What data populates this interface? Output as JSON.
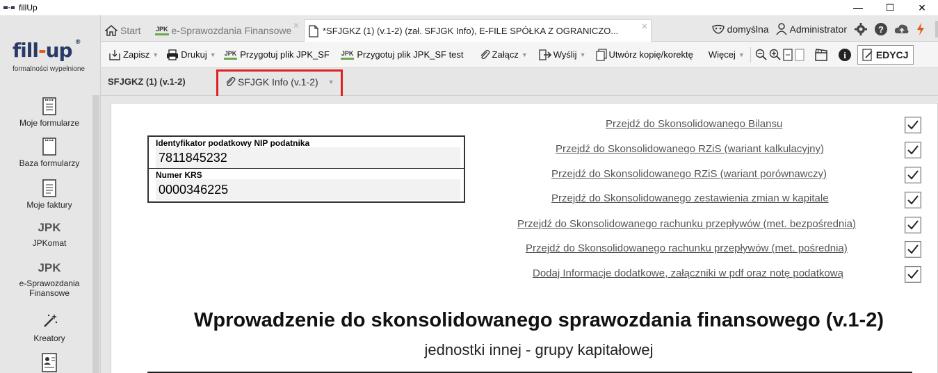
{
  "window": {
    "title": "fillUp",
    "controls": {
      "minimize": "—",
      "maximize": "☐",
      "close": "✕"
    }
  },
  "sidebar": {
    "logo": {
      "main_left": "fill",
      "main_dash": "-",
      "main_right": "up",
      "registered": "®",
      "tagline": "formalności wypełnione"
    },
    "items": [
      {
        "label": "Moje formularze",
        "icon": "list-document-icon"
      },
      {
        "label": "Baza formularzy",
        "icon": "blank-document-icon"
      },
      {
        "label": "Moje faktury",
        "icon": "invoice-document-icon"
      },
      {
        "label": "JPKomat",
        "badge": "JPK"
      },
      {
        "label": "e-Sprawozdania Finansowe",
        "badge": "JPK"
      },
      {
        "label": "Kreatory",
        "icon": "magic-wand-icon"
      }
    ]
  },
  "tabs": [
    {
      "label": "Start"
    },
    {
      "label": "e-Sprawozdania Finansowe",
      "badge": "JPK"
    },
    {
      "label": "*SFJGKZ (1) (v.1-2) (zał. SFJGK Info), E-FILE SPÓŁKA Z OGRANICZO..."
    }
  ],
  "status": {
    "profile": "domyślna",
    "user": "Administrator"
  },
  "toolbar": {
    "save": "Zapisz",
    "print": "Drukuj",
    "jpk_badge": "JPK",
    "prepare_jpk": "Przygotuj plik JPK_SF",
    "prepare_jpk_test": "Przygotuj plik JPK_SF test",
    "attach": "Załącz",
    "send": "Wyślij",
    "copy": "Utwórz kopię/korektę",
    "more": "Więcej",
    "edit_mode": "EDYCJ"
  },
  "subtabs": {
    "main": "SFJGKZ (1) (v.1-2)",
    "info": "SFJGK Info (v.1-2)"
  },
  "form": {
    "nip_label": "Identyfikator podatkowy NIP podatnika",
    "nip_value": "7811845232",
    "krs_label": "Numer KRS",
    "krs_value": "0000346225"
  },
  "links": [
    "Przejdź do Skonsolidowanego Bilansu",
    "Przejdź do Skonsolidowanego RZiS (wariant kalkulacyjny)",
    "Przejdź do Skonsolidowanego RZiS (wariant porównawczy)",
    "Przejdź do Skonsolidowanego zestawienia zmian w kapitale",
    "Przejdź do Skonsolidowanego rachunku przepływów (met. bezpośrednia)",
    "Przejdź do Skonsolidowanego rachunku przepływów (met. pośrednia)",
    "Dodaj Informacje dodatkowe, załączniki w pdf oraz notę podatkową"
  ],
  "document": {
    "title": "Wprowadzenie do skonsolidowanego sprawozdania finansowego (v.1-2)",
    "subtitle": "jednostki innej - grupy kapitałowej"
  },
  "colors": {
    "highlight": "#e02020",
    "logo_blue": "#2a3a66",
    "logo_orange": "#e05a10",
    "jpk_green": "#6aa84f"
  }
}
